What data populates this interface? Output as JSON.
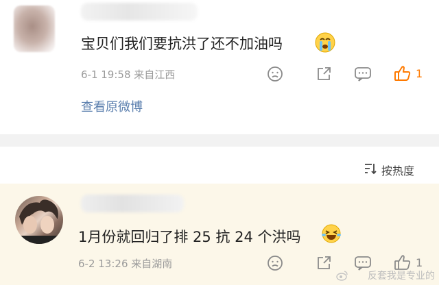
{
  "comment1": {
    "text": "宝贝们我们要抗洪了还不加油吗",
    "emoji": "crying-face",
    "meta": "6-1 19:58  来自江西",
    "like_count": "1",
    "view_original": "查看原微博"
  },
  "sort_label": "按热度",
  "comment2": {
    "text": "1月份就回归了排 25 抗 24 个洪吗",
    "emoji": "laughing-tears-face",
    "meta": "6-2 13:26  来自湖南",
    "like_count": "1"
  },
  "watermark": "反套我是专业的",
  "colors": {
    "link": "#5b7fae",
    "like_active": "#ff7a00",
    "meta_gray": "#9a9a9a",
    "reply_bg": "#fcf7e9"
  }
}
